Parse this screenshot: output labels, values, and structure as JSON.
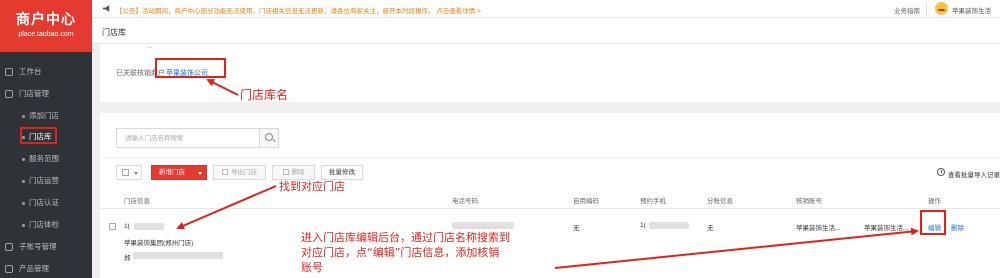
{
  "logo": {
    "title": "商户中心",
    "subtitle": "place.taobao.com"
  },
  "topbar": {
    "notice": "【公告】活动期间，商户中心部分功能无法使用，门店相关信息无法更新，请各位商家关注，避开本时段操作。 点击查看详情 >",
    "help": "业务指南",
    "user": "苹果装饰生活"
  },
  "sidebar": {
    "items": [
      {
        "label": "工作台"
      },
      {
        "label": "门店管理"
      },
      {
        "label": "添加门店"
      },
      {
        "label": "门店库"
      },
      {
        "label": "服务范围"
      },
      {
        "label": "门店运营"
      },
      {
        "label": "门店认证"
      },
      {
        "label": "门店体检"
      },
      {
        "label": "子账号管理"
      },
      {
        "label": "产品管理"
      }
    ]
  },
  "page": {
    "title": "门店库"
  },
  "info": {
    "top_text": "...",
    "linked_label": "已关联核销商户",
    "linked_value": "苹果装饰公司"
  },
  "search": {
    "placeholder": "请输入门店名称搜索"
  },
  "toolbar": {
    "add": "新增门店",
    "export": "导出门店",
    "delete": "删除",
    "batch_edit": "批量修改",
    "log": "查看批量导入记录"
  },
  "table": {
    "headers": [
      "门店信息",
      "电话号码",
      "自用编码",
      "预约手机",
      "分账信息",
      "核销账号",
      "操作"
    ],
    "row": {
      "store_id_prefix": "1(",
      "store_name": "苹果装饰集团(郑州门店)",
      "address_prefix": "郑",
      "phone": "",
      "code": "无",
      "mobile_prefix": "1(",
      "split": "无",
      "account": "苹果装饰生活...",
      "account2": "苹果装饰生活...",
      "edit": "编辑",
      "remove": "删除"
    }
  },
  "annotations": {
    "a1": "门店库名",
    "a2": "找到对应门店",
    "a3_line1": "进入门店库编辑后台，通过门店名称搜索到",
    "a3_line2": "对应门店，点“编辑”门店信息，添加核销",
    "a3_line3": "账号"
  },
  "colors": {
    "brand": "#e43a30",
    "annotation": "#e0231a",
    "link": "#1a73e8"
  }
}
